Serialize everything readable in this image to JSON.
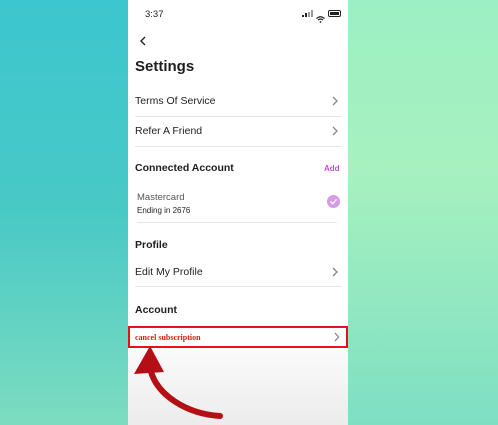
{
  "status": {
    "time": "3:37"
  },
  "header": {
    "title": "Settings"
  },
  "rows": {
    "terms": "Terms Of Service",
    "refer": "Refer A Friend",
    "edit_profile": "Edit My Profile",
    "cancel": "cancel subscription"
  },
  "sections": {
    "connected": "Connected Account",
    "add": "Add",
    "profile": "Profile",
    "account": "Account"
  },
  "card": {
    "name": "Mastercard",
    "ending": "Ending in 2676"
  },
  "colors": {
    "accent": "#c44fd6",
    "highlight": "#e0141a",
    "check": "#d59be3"
  }
}
